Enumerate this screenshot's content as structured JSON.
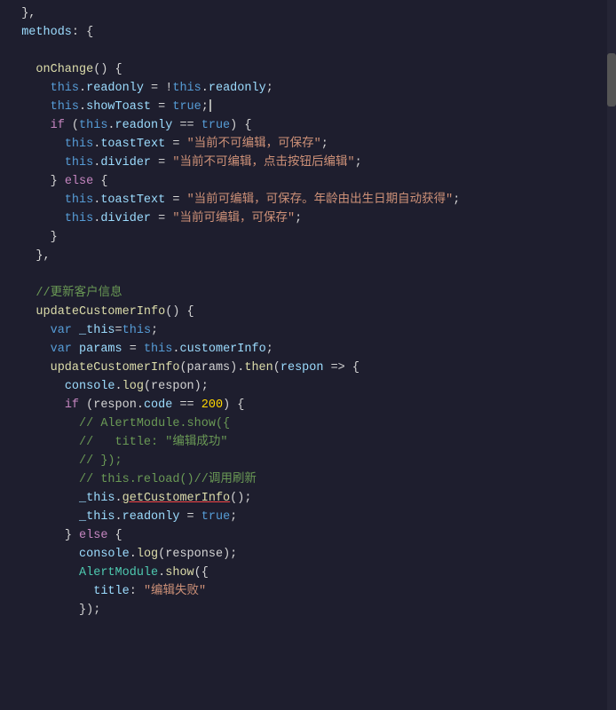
{
  "bg": "#1e1e2e",
  "lines": [
    {
      "id": 1,
      "indent": 0,
      "tokens": [
        {
          "t": "  },",
          "c": "c-white"
        }
      ]
    },
    {
      "id": 2,
      "indent": 0,
      "tokens": [
        {
          "t": "  ",
          "c": "c-white"
        },
        {
          "t": "methods",
          "c": "c-light-blue"
        },
        {
          "t": ": {",
          "c": "c-white"
        }
      ]
    },
    {
      "id": 3,
      "indent": 0,
      "tokens": []
    },
    {
      "id": 4,
      "indent": 0,
      "tokens": [
        {
          "t": "    ",
          "c": "c-white"
        },
        {
          "t": "onChange",
          "c": "c-yellow"
        },
        {
          "t": "() {",
          "c": "c-white"
        }
      ]
    },
    {
      "id": 5,
      "indent": 0,
      "tokens": [
        {
          "t": "      ",
          "c": "c-white"
        },
        {
          "t": "this",
          "c": "c-blue"
        },
        {
          "t": ".",
          "c": "c-white"
        },
        {
          "t": "readonly",
          "c": "c-light-blue"
        },
        {
          "t": " = ",
          "c": "c-white"
        },
        {
          "t": "!",
          "c": "c-white"
        },
        {
          "t": "this",
          "c": "c-blue"
        },
        {
          "t": ".",
          "c": "c-white"
        },
        {
          "t": "readonly",
          "c": "c-light-blue"
        },
        {
          "t": ";",
          "c": "c-white"
        }
      ]
    },
    {
      "id": 6,
      "indent": 0,
      "tokens": [
        {
          "t": "      ",
          "c": "c-white"
        },
        {
          "t": "this",
          "c": "c-blue"
        },
        {
          "t": ".",
          "c": "c-white"
        },
        {
          "t": "showToast",
          "c": "c-light-blue"
        },
        {
          "t": " = ",
          "c": "c-white"
        },
        {
          "t": "true",
          "c": "c-blue"
        },
        {
          "t": ";",
          "c": "c-white"
        },
        {
          "t": "CURSOR",
          "c": "cursor"
        }
      ]
    },
    {
      "id": 7,
      "indent": 0,
      "tokens": [
        {
          "t": "      ",
          "c": "c-white"
        },
        {
          "t": "if",
          "c": "c-pink"
        },
        {
          "t": " (",
          "c": "c-white"
        },
        {
          "t": "this",
          "c": "c-blue"
        },
        {
          "t": ".",
          "c": "c-white"
        },
        {
          "t": "readonly",
          "c": "c-light-blue"
        },
        {
          "t": " == ",
          "c": "c-white"
        },
        {
          "t": "true",
          "c": "c-blue"
        },
        {
          "t": ") {",
          "c": "c-white"
        }
      ]
    },
    {
      "id": 8,
      "indent": 0,
      "tokens": [
        {
          "t": "        ",
          "c": "c-white"
        },
        {
          "t": "this",
          "c": "c-blue"
        },
        {
          "t": ".",
          "c": "c-white"
        },
        {
          "t": "toastText",
          "c": "c-light-blue"
        },
        {
          "t": " = ",
          "c": "c-white"
        },
        {
          "t": "\"当前不可编辑，可保存\"",
          "c": "c-orange"
        },
        {
          "t": ";",
          "c": "c-white"
        }
      ]
    },
    {
      "id": 9,
      "indent": 0,
      "tokens": [
        {
          "t": "        ",
          "c": "c-white"
        },
        {
          "t": "this",
          "c": "c-blue"
        },
        {
          "t": ".",
          "c": "c-white"
        },
        {
          "t": "divider",
          "c": "c-light-blue"
        },
        {
          "t": " = ",
          "c": "c-white"
        },
        {
          "t": "\"当前不可编辑，点击按钮后编辑\"",
          "c": "c-orange"
        },
        {
          "t": ";",
          "c": "c-white"
        }
      ]
    },
    {
      "id": 10,
      "indent": 0,
      "tokens": [
        {
          "t": "      ",
          "c": "c-white"
        },
        {
          "t": "} ",
          "c": "c-white"
        },
        {
          "t": "else",
          "c": "c-pink"
        },
        {
          "t": " {",
          "c": "c-white"
        }
      ]
    },
    {
      "id": 11,
      "indent": 0,
      "tokens": [
        {
          "t": "        ",
          "c": "c-white"
        },
        {
          "t": "this",
          "c": "c-blue"
        },
        {
          "t": ".",
          "c": "c-white"
        },
        {
          "t": "toastText",
          "c": "c-light-blue"
        },
        {
          "t": " = ",
          "c": "c-white"
        },
        {
          "t": "\"当前可编辑，可保存。年龄由出生日期自动获得\"",
          "c": "c-orange"
        },
        {
          "t": ";",
          "c": "c-white"
        }
      ]
    },
    {
      "id": 12,
      "indent": 0,
      "tokens": [
        {
          "t": "        ",
          "c": "c-white"
        },
        {
          "t": "this",
          "c": "c-blue"
        },
        {
          "t": ".",
          "c": "c-white"
        },
        {
          "t": "divider",
          "c": "c-light-blue"
        },
        {
          "t": " = ",
          "c": "c-white"
        },
        {
          "t": "\"当前可编辑，可保存\"",
          "c": "c-orange"
        },
        {
          "t": ";",
          "c": "c-white"
        }
      ]
    },
    {
      "id": 13,
      "indent": 0,
      "tokens": [
        {
          "t": "      ",
          "c": "c-white"
        },
        {
          "t": "}",
          "c": "c-white"
        }
      ]
    },
    {
      "id": 14,
      "indent": 0,
      "tokens": [
        {
          "t": "    ",
          "c": "c-white"
        },
        {
          "t": "},",
          "c": "c-white"
        }
      ]
    },
    {
      "id": 15,
      "indent": 0,
      "tokens": []
    },
    {
      "id": 16,
      "indent": 0,
      "tokens": [
        {
          "t": "    ",
          "c": "c-white"
        },
        {
          "t": "//更新客户信息",
          "c": "c-comment"
        }
      ]
    },
    {
      "id": 17,
      "indent": 0,
      "tokens": [
        {
          "t": "    ",
          "c": "c-white"
        },
        {
          "t": "updateCustomerInfo",
          "c": "c-yellow"
        },
        {
          "t": "() {",
          "c": "c-white"
        }
      ]
    },
    {
      "id": 18,
      "indent": 0,
      "tokens": [
        {
          "t": "      ",
          "c": "c-white"
        },
        {
          "t": "var",
          "c": "c-blue"
        },
        {
          "t": " _this",
          "c": "c-light-blue"
        },
        {
          "t": "=",
          "c": "c-white"
        },
        {
          "t": "this",
          "c": "c-blue"
        },
        {
          "t": ";",
          "c": "c-white"
        }
      ]
    },
    {
      "id": 19,
      "indent": 0,
      "tokens": [
        {
          "t": "      ",
          "c": "c-white"
        },
        {
          "t": "var",
          "c": "c-blue"
        },
        {
          "t": " params",
          "c": "c-light-blue"
        },
        {
          "t": " = ",
          "c": "c-white"
        },
        {
          "t": "this",
          "c": "c-blue"
        },
        {
          "t": ".",
          "c": "c-white"
        },
        {
          "t": "customerInfo",
          "c": "c-light-blue"
        },
        {
          "t": ";",
          "c": "c-white"
        }
      ]
    },
    {
      "id": 20,
      "indent": 0,
      "tokens": [
        {
          "t": "      ",
          "c": "c-white"
        },
        {
          "t": "updateCustomerInfo",
          "c": "c-yellow"
        },
        {
          "t": "(params).",
          "c": "c-white"
        },
        {
          "t": "then",
          "c": "c-yellow"
        },
        {
          "t": "(",
          "c": "c-white"
        },
        {
          "t": "respon",
          "c": "c-light-blue"
        },
        {
          "t": " => {",
          "c": "c-white"
        }
      ]
    },
    {
      "id": 21,
      "indent": 0,
      "tokens": [
        {
          "t": "        ",
          "c": "c-white"
        },
        {
          "t": "console",
          "c": "c-light-blue"
        },
        {
          "t": ".",
          "c": "c-white"
        },
        {
          "t": "log",
          "c": "c-yellow"
        },
        {
          "t": "(respon);",
          "c": "c-white"
        }
      ]
    },
    {
      "id": 22,
      "indent": 0,
      "tokens": [
        {
          "t": "        ",
          "c": "c-white"
        },
        {
          "t": "if",
          "c": "c-pink"
        },
        {
          "t": " (respon.",
          "c": "c-white"
        },
        {
          "t": "code",
          "c": "c-light-blue"
        },
        {
          "t": " == ",
          "c": "c-white"
        },
        {
          "t": "200",
          "c": "c-gold"
        },
        {
          "t": ") {",
          "c": "c-white"
        }
      ]
    },
    {
      "id": 23,
      "indent": 0,
      "tokens": [
        {
          "t": "          ",
          "c": "c-white"
        },
        {
          "t": "// AlertModule.show({",
          "c": "c-comment"
        }
      ]
    },
    {
      "id": 24,
      "indent": 0,
      "tokens": [
        {
          "t": "          ",
          "c": "c-white"
        },
        {
          "t": "//   title: \"编辑成功\"",
          "c": "c-comment"
        }
      ]
    },
    {
      "id": 25,
      "indent": 0,
      "tokens": [
        {
          "t": "          ",
          "c": "c-white"
        },
        {
          "t": "// });",
          "c": "c-comment"
        }
      ]
    },
    {
      "id": 26,
      "indent": 0,
      "tokens": [
        {
          "t": "          ",
          "c": "c-white"
        },
        {
          "t": "// this.reload()//调用刷新",
          "c": "c-comment"
        }
      ]
    },
    {
      "id": 27,
      "indent": 0,
      "tokens": [
        {
          "t": "          ",
          "c": "c-white"
        },
        {
          "t": "_this",
          "c": "c-light-blue"
        },
        {
          "t": ".",
          "c": "c-white"
        },
        {
          "t": "getCustomerInfo",
          "c": "c-yellow",
          "underline": true
        },
        {
          "t": "();",
          "c": "c-white"
        }
      ]
    },
    {
      "id": 28,
      "indent": 0,
      "tokens": [
        {
          "t": "          ",
          "c": "c-white"
        },
        {
          "t": "_this",
          "c": "c-light-blue"
        },
        {
          "t": ".",
          "c": "c-white"
        },
        {
          "t": "readonly",
          "c": "c-light-blue"
        },
        {
          "t": " = ",
          "c": "c-white"
        },
        {
          "t": "true",
          "c": "c-blue"
        },
        {
          "t": ";",
          "c": "c-white"
        }
      ]
    },
    {
      "id": 29,
      "indent": 0,
      "tokens": [
        {
          "t": "        ",
          "c": "c-white"
        },
        {
          "t": "} ",
          "c": "c-white"
        },
        {
          "t": "else",
          "c": "c-pink"
        },
        {
          "t": " {",
          "c": "c-white"
        }
      ]
    },
    {
      "id": 30,
      "indent": 0,
      "tokens": [
        {
          "t": "          ",
          "c": "c-white"
        },
        {
          "t": "console",
          "c": "c-light-blue"
        },
        {
          "t": ".",
          "c": "c-white"
        },
        {
          "t": "log",
          "c": "c-yellow"
        },
        {
          "t": "(response);",
          "c": "c-white"
        }
      ]
    },
    {
      "id": 31,
      "indent": 0,
      "tokens": [
        {
          "t": "          ",
          "c": "c-white"
        },
        {
          "t": "AlertModule",
          "c": "c-teal"
        },
        {
          "t": ".",
          "c": "c-white"
        },
        {
          "t": "show",
          "c": "c-yellow"
        },
        {
          "t": "({",
          "c": "c-white"
        }
      ]
    },
    {
      "id": 32,
      "indent": 0,
      "tokens": [
        {
          "t": "            ",
          "c": "c-white"
        },
        {
          "t": "title",
          "c": "c-light-blue"
        },
        {
          "t": ": ",
          "c": "c-white"
        },
        {
          "t": "\"编辑失败\"",
          "c": "c-orange"
        }
      ]
    },
    {
      "id": 33,
      "indent": 0,
      "tokens": [
        {
          "t": "          ",
          "c": "c-white"
        },
        {
          "t": "});",
          "c": "c-white"
        }
      ]
    }
  ]
}
